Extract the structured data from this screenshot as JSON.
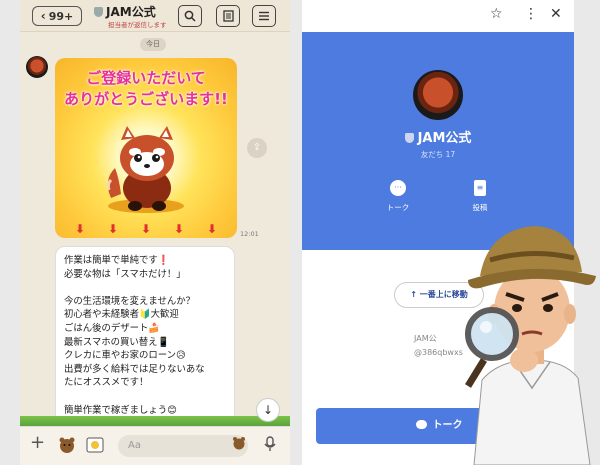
{
  "left": {
    "back_count": "99+",
    "title": "JAM公式",
    "subtitle": "担当者が返信します",
    "date_chip": "今日",
    "image_text_line1": "ご登録いただいて",
    "image_text_line2": "ありがとうございます!!",
    "time": "12:01",
    "message_lines": [
      "作業は簡単で単純です❗",
      "必要な物は「スマホだけ！」",
      "",
      "今の生活環境を変えませんか？",
      "初心者や未経験者🔰大歓迎",
      "ごはん後のデザート🍰",
      "最新スマホの買い替え📱",
      "クレカに車やお家のローン😥",
      "出費が多く給料では足りないあな",
      "たにオススメです！",
      "",
      "簡単作業で稼ぎましょう😊"
    ],
    "input_placeholder": "Aa"
  },
  "right": {
    "name": "JAM公式",
    "friends": "友だち 17",
    "action_talk": "トーク",
    "action_post": "投稿",
    "move_top": "↑ 一番上に移動",
    "info_name": "JAM公",
    "info_id": "@386qbwxs",
    "talk_button": "トーク"
  },
  "colors": {
    "line_blue": "#4e7be0",
    "chat_bg": "#efe9dc",
    "pink_text": "#e6309a"
  }
}
